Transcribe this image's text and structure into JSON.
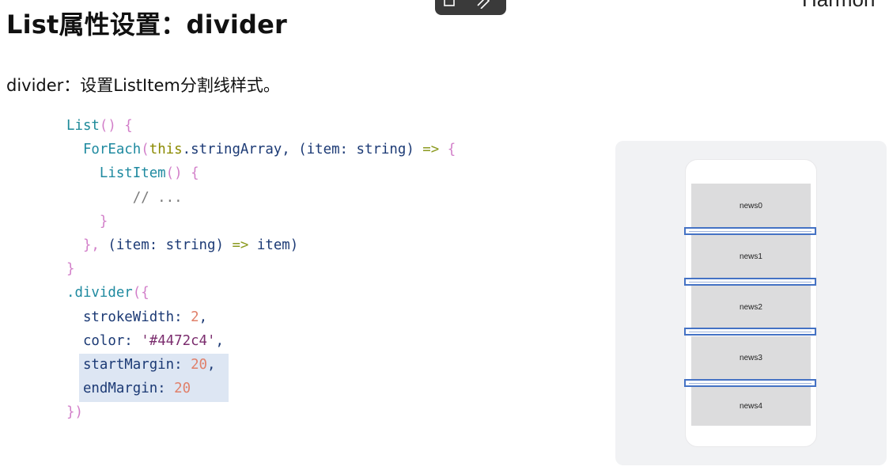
{
  "header": {
    "title": "List属性设置：divider",
    "brand": "Harmon"
  },
  "subtitle": "divider：设置ListItem分割线样式。",
  "code": {
    "l1_a": "List",
    "l1_b": "() {",
    "l2_a": "ForEach",
    "l2_b": "(",
    "l2_c": "this",
    "l2_d": ".stringArray, (item: ",
    "l2_e": "string",
    "l2_f": ") ",
    "l2_g": "=>",
    "l2_h": " {",
    "l3_a": "ListItem",
    "l3_b": "() {",
    "l4": "// ...",
    "l5": "}",
    "l6_a": "}, ",
    "l6_b": "(item: ",
    "l6_c": "string",
    "l6_d": ") ",
    "l6_e": "=>",
    "l6_f": " item)",
    "l7": "}",
    "l8_a": ".divider",
    "l8_b": "({",
    "l9_a": "strokeWidth: ",
    "l9_b": "2",
    "l9_c": ",",
    "l10_a": "color: ",
    "l10_b": "'#4472c4'",
    "l10_c": ",",
    "l11_a": "startMargin: ",
    "l11_b": "20",
    "l11_c": ",",
    "l12_a": "endMargin: ",
    "l12_b": "20",
    "l13": "})"
  },
  "preview": {
    "items": [
      "news0",
      "news1",
      "news2",
      "news3",
      "news4"
    ],
    "divider_color": "#4472c4"
  }
}
